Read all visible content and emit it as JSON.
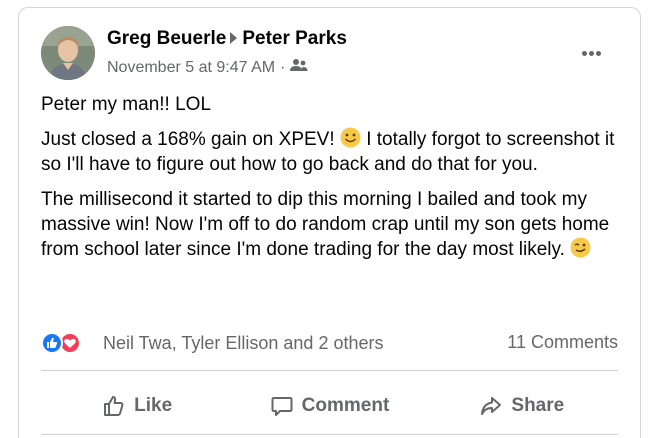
{
  "post": {
    "author": "Greg Beuerle",
    "recipient": "Peter Parks",
    "timestamp": "November 5 at 9:47 AM",
    "separator": "·",
    "audience_icon": "friends-icon",
    "paragraphs": {
      "p1": "Peter my man!! LOL",
      "p2a": "Just closed a 168% gain on XPEV! ",
      "p2b": " I totally forgot to screenshot it so I'll have to figure out how to go back and do that for you.",
      "p3": "The millisecond it started to dip this morning I bailed and took my massive win! Now I'm off to do random crap until my son gets home from school later since I'm done trading for the day most likely. "
    }
  },
  "reactions": {
    "names": "Neil Twa, Tyler Ellison and 2 others",
    "comments": "11 Comments",
    "icons": [
      "like-reaction-icon",
      "love-reaction-icon"
    ]
  },
  "actions": {
    "like": "Like",
    "comment": "Comment",
    "share": "Share"
  },
  "colors": {
    "text": "#050505",
    "secondary": "#65676b",
    "like_blue": "#1877f2",
    "love_red": "#f33e58",
    "border": "#d4d6da"
  }
}
